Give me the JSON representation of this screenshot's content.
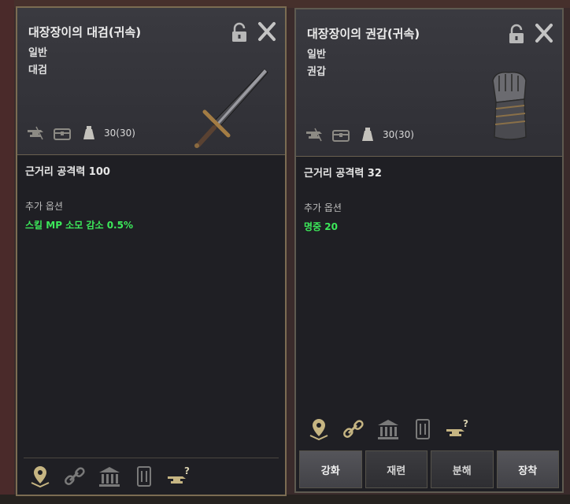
{
  "left_item": {
    "name": "대장장이의 대검(귀속)",
    "grade": "일반",
    "type": "대검",
    "weight": "30(30)",
    "stat": "근거리 공격력 100",
    "option_label": "추가 옵션",
    "option_value": "스킬 MP 소모 감소 0.5%"
  },
  "right_item": {
    "name": "대장장이의 권갑(귀속)",
    "grade": "일반",
    "type": "권갑",
    "weight": "30(30)",
    "stat": "근거리 공격력 32",
    "option_label": "추가 옵션",
    "option_value": "명중 20"
  },
  "actions": {
    "enhance": "강화",
    "refine": "재련",
    "disassemble": "분해",
    "equip": "장착"
  },
  "colors": {
    "option_green": "#3ce85a",
    "frame_gold": "#7b6c52"
  },
  "icons": [
    "lock-icon",
    "close-icon",
    "anvil-icon",
    "chest-icon",
    "weight-icon",
    "location-icon",
    "link-icon",
    "bank-icon",
    "trade-icon",
    "anvil-question-icon"
  ]
}
